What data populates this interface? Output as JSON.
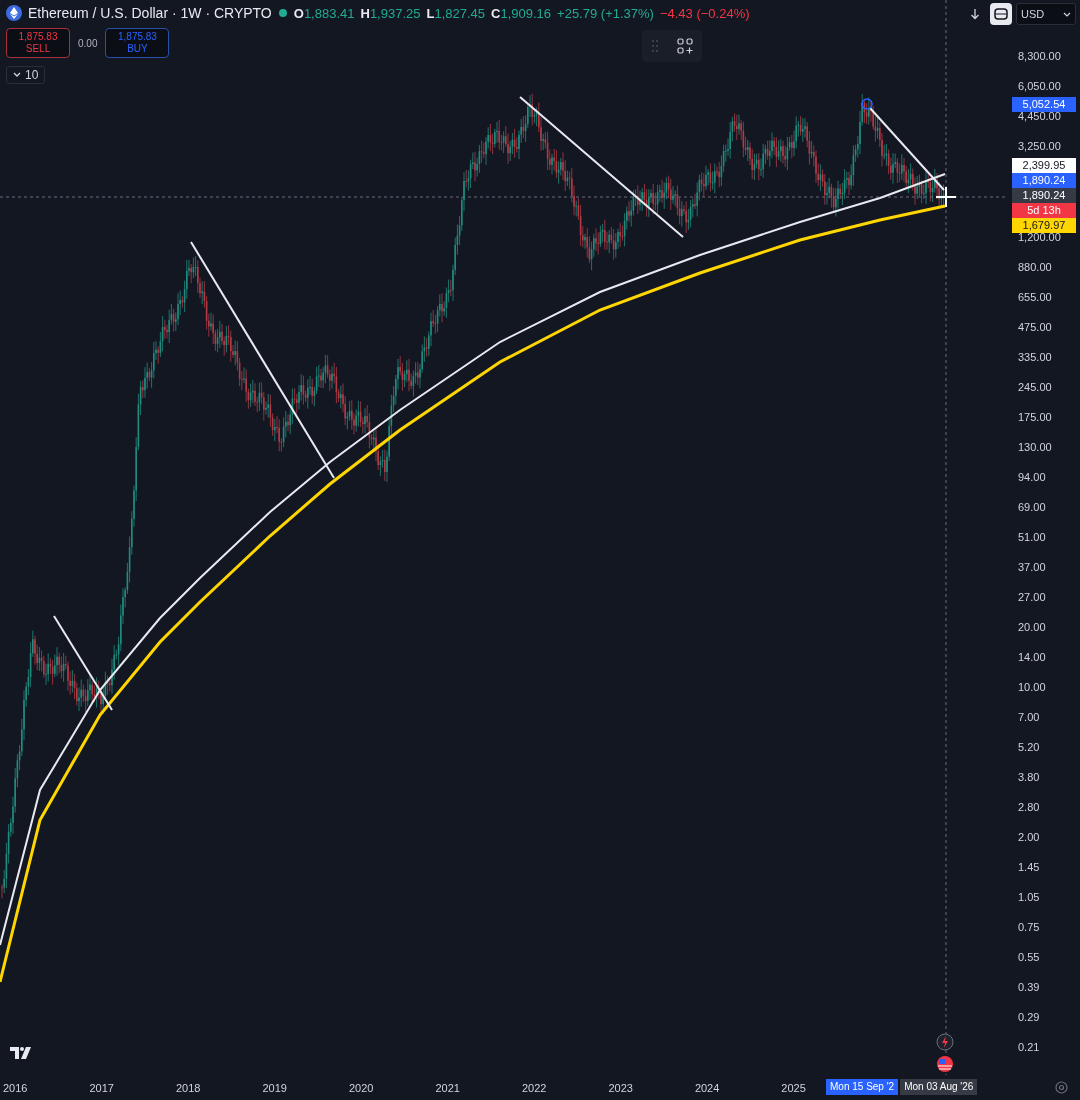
{
  "header": {
    "symbol": "Ethereum / U.S. Dollar · 1W · CRYPTO",
    "ohlc": [
      {
        "label": "O",
        "value": "1,883.41"
      },
      {
        "label": "H",
        "value": "1,937.25"
      },
      {
        "label": "L",
        "value": "1,827.45"
      },
      {
        "label": "C",
        "value": "1,909.16"
      }
    ],
    "change": "+25.79 (+1.37%)",
    "pending_change": "−4.43 (−0.24%)"
  },
  "trade": {
    "sell": {
      "price": "1,875.83",
      "label": "SELL"
    },
    "spread": "0.00",
    "buy": {
      "price": "1,875.83",
      "label": "BUY"
    }
  },
  "indicators_toggle": "10",
  "currency": "USD",
  "price_axis": {
    "ticks": [
      "8,300.00",
      "6,050.00",
      "4,450.00",
      "3,250.00",
      "1,200.00",
      "880.00",
      "655.00",
      "475.00",
      "335.00",
      "245.00",
      "175.00",
      "130.00",
      "94.00",
      "69.00",
      "51.00",
      "37.00",
      "27.00",
      "20.00",
      "14.00",
      "10.00",
      "7.00",
      "5.20",
      "3.80",
      "2.80",
      "2.00",
      "1.45",
      "1.05",
      "0.75",
      "0.55",
      "0.39",
      "0.29",
      "0.21"
    ],
    "labels": [
      {
        "text": "5,052.54",
        "color": "#2962ff"
      },
      {
        "text": "2,399.95",
        "color": "#ffffff"
      },
      {
        "text": "1,890.24",
        "color": "#2962ff"
      },
      {
        "text": "1,890.24",
        "color": "#363a45"
      },
      {
        "text": "5d 13h",
        "color": "#f23645"
      },
      {
        "text": "1,679.97",
        "color": "#ffd600"
      }
    ]
  },
  "time_axis": {
    "years": [
      "2016",
      "2017",
      "2018",
      "2019",
      "2020",
      "2021",
      "2022",
      "2023",
      "2024",
      "2025"
    ],
    "cursor_labels": [
      {
        "text": "Mon 15 Sep '2",
        "color": "#2962ff"
      },
      {
        "text": "Mon 03 Aug '26",
        "color": "#363a45"
      }
    ]
  }
}
